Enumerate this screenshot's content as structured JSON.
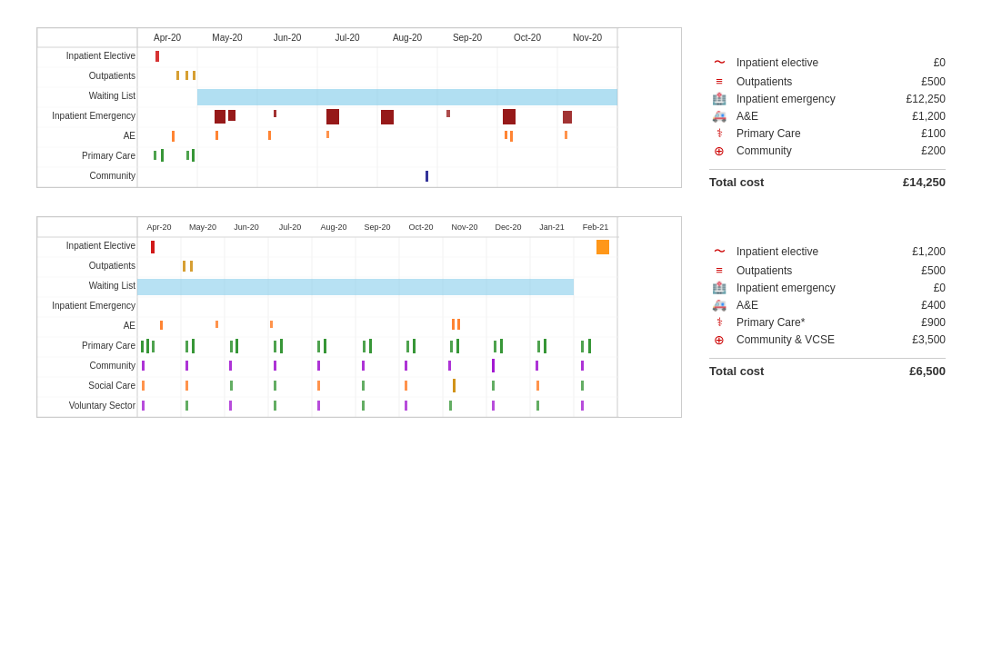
{
  "chart1": {
    "months": [
      "Apr-20",
      "May-20",
      "Jun-20",
      "Jul-20",
      "Aug-20",
      "Sep-20",
      "Oct-20",
      "Nov-20"
    ],
    "rows": [
      "Inpatient Elective",
      "Outpatients",
      "Waiting List",
      "Inpatient Emergency",
      "AE",
      "Primary Care",
      "Community"
    ],
    "legend": [
      {
        "icon": "pulse",
        "label": "Inpatient elective",
        "cost": "£0"
      },
      {
        "icon": "list",
        "label": "Outpatients",
        "cost": "£500"
      },
      {
        "icon": "hospital",
        "label": "Inpatient emergency",
        "cost": "£12,250"
      },
      {
        "icon": "ambulance",
        "label": "A&E",
        "cost": "£1,200"
      },
      {
        "icon": "stethoscope",
        "label": "Primary Care",
        "cost": "£100"
      },
      {
        "icon": "plus-circle",
        "label": "Community",
        "cost": "£200"
      }
    ],
    "total_label": "Total cost",
    "total_value": "£14,250"
  },
  "chart2": {
    "months": [
      "Apr-20",
      "May-20",
      "Jun-20",
      "Jul-20",
      "Aug-20",
      "Sep-20",
      "Oct-20",
      "Nov-20",
      "Dec-20",
      "Jan-21",
      "Feb-21"
    ],
    "rows": [
      "Inpatient Elective",
      "Outpatients",
      "Waiting List",
      "Inpatient Emergency",
      "AE",
      "Primary Care",
      "Community",
      "Social Care",
      "Voluntary Sector"
    ],
    "legend": [
      {
        "icon": "pulse",
        "label": "Inpatient elective",
        "cost": "£1,200"
      },
      {
        "icon": "list",
        "label": "Outpatients",
        "cost": "£500"
      },
      {
        "icon": "hospital",
        "label": "Inpatient emergency",
        "cost": "£0"
      },
      {
        "icon": "ambulance",
        "label": "A&E",
        "cost": "£400"
      },
      {
        "icon": "stethoscope",
        "label": "Primary Care*",
        "cost": "£900"
      },
      {
        "icon": "plus-circle",
        "label": "Community & VCSE",
        "cost": "£3,500"
      }
    ],
    "total_label": "Total cost",
    "total_value": "£6,500"
  }
}
